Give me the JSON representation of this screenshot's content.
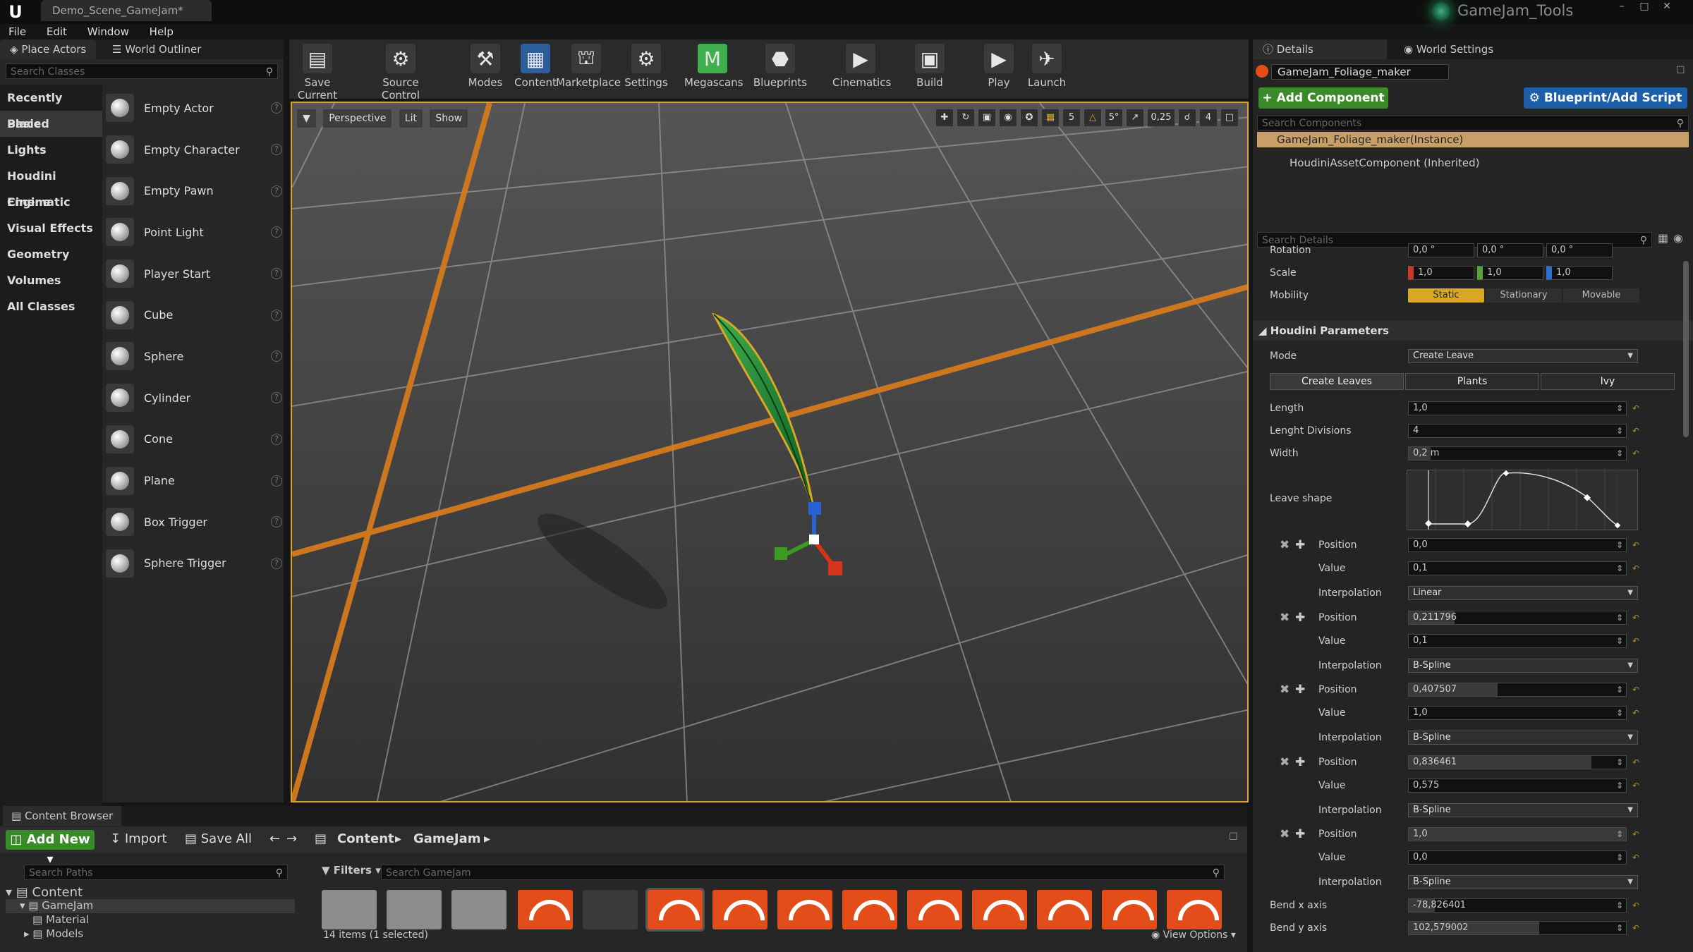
{
  "window": {
    "doc_tab": "Demo_Scene_GameJam*",
    "plugin": "GameJam_Tools"
  },
  "menu": [
    "File",
    "Edit",
    "Window",
    "Help"
  ],
  "left_tabs": {
    "place": "Place Actors",
    "outliner": "World Outliner"
  },
  "place_search_placeholder": "Search Classes",
  "categories": [
    "Recently Placed",
    "Basic",
    "Lights",
    "Houdini Engine",
    "Cinematic",
    "Visual Effects",
    "Geometry",
    "Volumes",
    "All Classes"
  ],
  "actors": [
    "Empty Actor",
    "Empty Character",
    "Empty Pawn",
    "Point Light",
    "Player Start",
    "Cube",
    "Sphere",
    "Cylinder",
    "Cone",
    "Plane",
    "Box Trigger",
    "Sphere Trigger"
  ],
  "toolbar": [
    "Save Current",
    "Source Control",
    "Modes",
    "Content",
    "Marketplace",
    "Settings",
    "Megascans",
    "Blueprints",
    "Cinematics",
    "Build",
    "Play",
    "Launch"
  ],
  "viewport": {
    "view": "Perspective",
    "lit": "Lit",
    "show": "Show",
    "grid": "5",
    "angle": "5°",
    "scale": "0,25",
    "cam": "4"
  },
  "details": {
    "tab": "Details",
    "world_tab": "World Settings",
    "actor_name": "GameJam_Foliage_maker",
    "add_component": "+ Add Component",
    "blueprint": "Blueprint/Add Script",
    "search_components": "Search Components",
    "components": [
      "GameJam_Foliage_maker(Instance)",
      "HoudiniAssetComponent (Inherited)"
    ],
    "search_details": "Search Details",
    "rotation": "Rotation",
    "rot_vals": [
      "0,0 °",
      "0,0 °",
      "0,0 °"
    ],
    "scale": "Scale",
    "scale_vals": [
      "1,0",
      "1,0",
      "1,0"
    ],
    "mobility": "Mobility",
    "mobility_opts": [
      "Static",
      "Stationary",
      "Movable"
    ],
    "section": "Houdini Parameters",
    "mode_label": "Mode",
    "mode_value": "Create Leave",
    "tabs": [
      "Create Leaves",
      "Plants",
      "Ivy"
    ],
    "length": {
      "label": "Length",
      "value": "1,0"
    },
    "divisions": {
      "label": "Lenght Divisions",
      "value": "4"
    },
    "width": {
      "label": "Width",
      "value": "0,2 m"
    },
    "leave_shape": "Leave shape",
    "points": [
      {
        "pos": "0,0",
        "val": "0,1",
        "interp": "Linear",
        "pos_fill": 0
      },
      {
        "pos": "0,211796",
        "val": "0,1",
        "interp": "B-Spline",
        "pos_fill": 0.21
      },
      {
        "pos": "0,407507",
        "val": "1,0",
        "interp": "B-Spline",
        "pos_fill": 0.41
      },
      {
        "pos": "0,836461",
        "val": "0,575",
        "interp": "B-Spline",
        "pos_fill": 0.84
      },
      {
        "pos": "1,0",
        "val": "0,0",
        "interp": "B-Spline",
        "pos_fill": 1.0
      }
    ],
    "labels": {
      "position": "Position",
      "value": "Value",
      "interpolation": "Interpolation"
    },
    "bend_x": {
      "label": "Bend x axis",
      "value": "-78,826401"
    },
    "bend_y": {
      "label": "Bend y axis",
      "value": "102,579002"
    }
  },
  "content_browser": {
    "tab": "Content Browser",
    "add_new": "Add New",
    "import": "Import",
    "save_all": "Save All",
    "crumb_root": "Content",
    "crumb_folder": "GameJam",
    "search_paths": "Search Paths",
    "filters": "Filters",
    "search_assets": "Search GameJam",
    "tree": [
      "Content",
      "GameJam",
      "Material",
      "Models"
    ],
    "status": "14 items (1 selected)",
    "view_options": "View Options"
  }
}
